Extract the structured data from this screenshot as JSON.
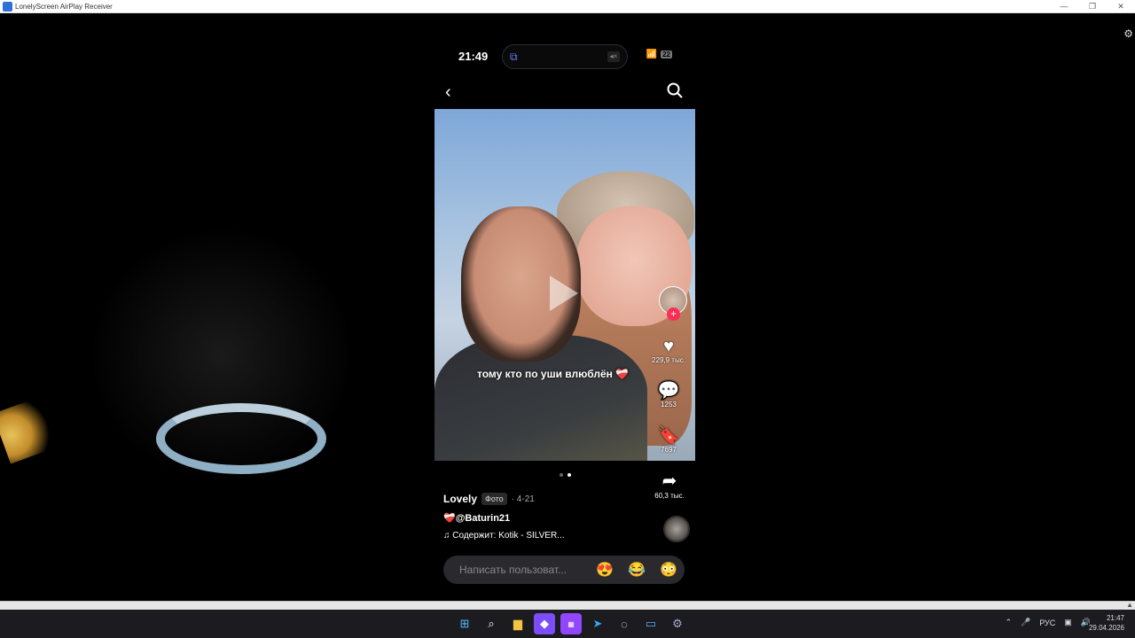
{
  "window": {
    "title": "LonelyScreen AirPlay Receiver",
    "minimize": "—",
    "maximize": "❐",
    "close": "✕"
  },
  "phone": {
    "status": {
      "time": "21:49",
      "battery": "22"
    },
    "post": {
      "caption": "тому кто по уши влюблён ❤️‍🩹",
      "likes": "229,9 тыс.",
      "comments": "1253",
      "saves": "7697",
      "shares": "60,3 тыс.",
      "author": "Lovely",
      "type_tag": "Фото",
      "date": "· 4-21",
      "mention": "❤️‍🩹@Baturin21",
      "music": "♫ Содержит: Kotik - SILVER...",
      "slide_current": 2,
      "slide_total": 2
    },
    "comment_input": {
      "placeholder": "Написать пользоват...",
      "emojis": [
        "😍",
        "😂",
        "😳"
      ]
    }
  },
  "taskbar": {
    "icons": [
      "windows-start-icon",
      "search-icon",
      "file-explorer-icon",
      "obsidian-icon",
      "twitch-icon",
      "telegram-icon",
      "app-icon",
      "remote-desktop-icon",
      "settings-icon"
    ],
    "language": "РУС",
    "time": "21:47",
    "date": "29.04.2026"
  },
  "colors": {
    "accent_pink": "#fe2c55",
    "taskbar": "#1c1b1f"
  }
}
